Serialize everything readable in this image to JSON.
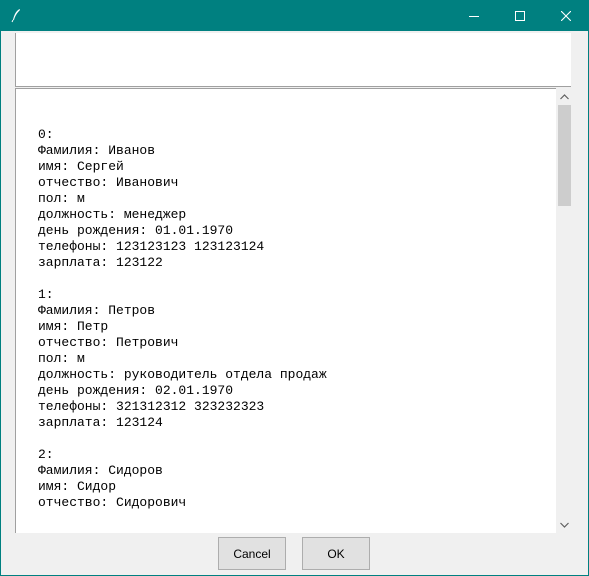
{
  "window": {
    "title": "",
    "app_icon": "feather-icon",
    "controls": [
      "minimize-icon",
      "maximize-icon",
      "close-icon"
    ],
    "accent": "#008080"
  },
  "top_entry": {
    "value": ""
  },
  "records": [
    {
      "index": "0:",
      "lines": [
        "Фамилия: Иванов",
        "имя: Сергей",
        "отчество: Иванович",
        "пол: м",
        "должность: менеджер",
        "день рождения: 01.01.1970",
        "телефоны: 123123123 123123124",
        "зарплата: 123122"
      ]
    },
    {
      "index": "1:",
      "lines": [
        "Фамилия: Петров",
        "имя: Петр",
        "отчество: Петрович",
        "пол: м",
        "должность: руководитель отдела продаж",
        "день рождения: 02.01.1970",
        "телефоны: 321312312 323232323",
        "зарплата: 123124"
      ]
    },
    {
      "index": "2:",
      "lines": [
        "Фамилия: Сидоров",
        "имя: Сидор",
        "отчество: Сидорович"
      ]
    }
  ],
  "buttons": {
    "cancel": "Cancel",
    "ok": "OK"
  }
}
